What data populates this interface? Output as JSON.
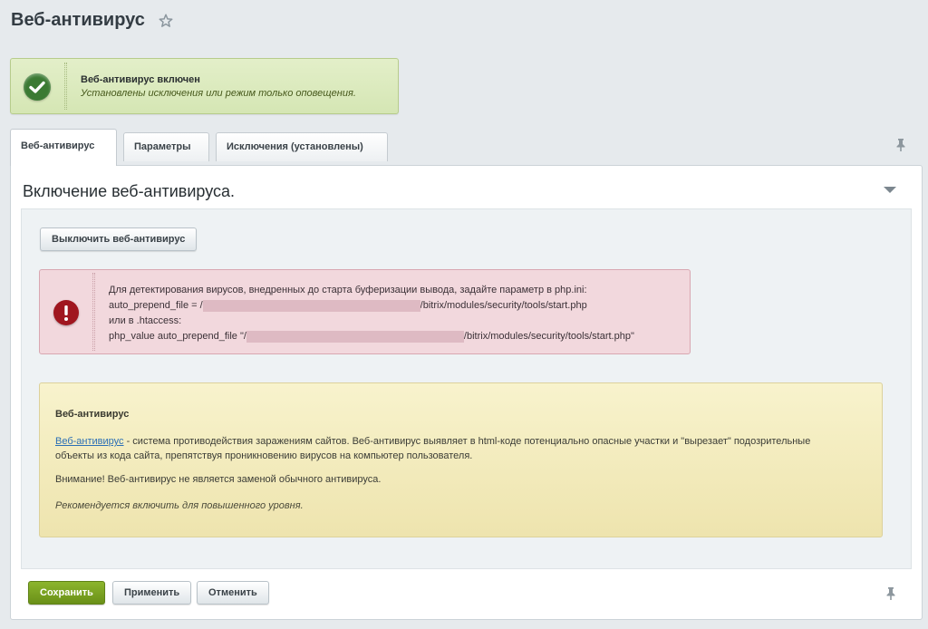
{
  "page": {
    "title": "Веб-антивирус"
  },
  "status": {
    "title": "Веб-антивирус включен",
    "description": "Установлены исключения или режим только оповещения."
  },
  "tabs": [
    {
      "label": "Веб-антивирус",
      "active": true
    },
    {
      "label": "Параметры",
      "active": false
    },
    {
      "label": "Исключения (установлены)",
      "active": false
    }
  ],
  "section": {
    "title": "Включение веб-антивируса."
  },
  "disable_button": "Выключить веб-антивирус",
  "error": {
    "line1": "Для детектирования вирусов, внедренных до старта буферизации вывода, задайте параметр в php.ini:",
    "line2_prefix": "auto_prepend_file = /",
    "line2_suffix": "/bitrix/modules/security/tools/start.php",
    "line3": "или в .htaccess:",
    "line4_prefix": "php_value auto_prepend_file \"/",
    "line4_suffix": "/bitrix/modules/security/tools/start.php\""
  },
  "info": {
    "title": "Веб-антивирус",
    "link_text": "Веб-антивирус",
    "description": " - система противодействия заражениям сайтов. Веб-антивирус выявляет в html-коде потенциально опасные участки и \"вырезает\" подозрительные объекты из кода сайта, препятствуя проникновению вирусов на компьютер пользователя.",
    "warning": "Внимание! Веб-антивирус не является заменой обычного антивируса.",
    "recommendation": "Рекомендуется включить для повышенного уровня."
  },
  "footer": {
    "save": "Сохранить",
    "apply": "Применить",
    "cancel": "Отменить"
  },
  "colors": {
    "success": "#3b7a33",
    "error": "#a0161f",
    "save_button": "#7aa323",
    "link": "#2c6fb5"
  },
  "icons": {
    "status": "check-circle-icon",
    "error": "exclamation-circle-icon",
    "favorite": "star-icon",
    "pin": "pin-icon",
    "collapse": "triangle-down-icon"
  }
}
